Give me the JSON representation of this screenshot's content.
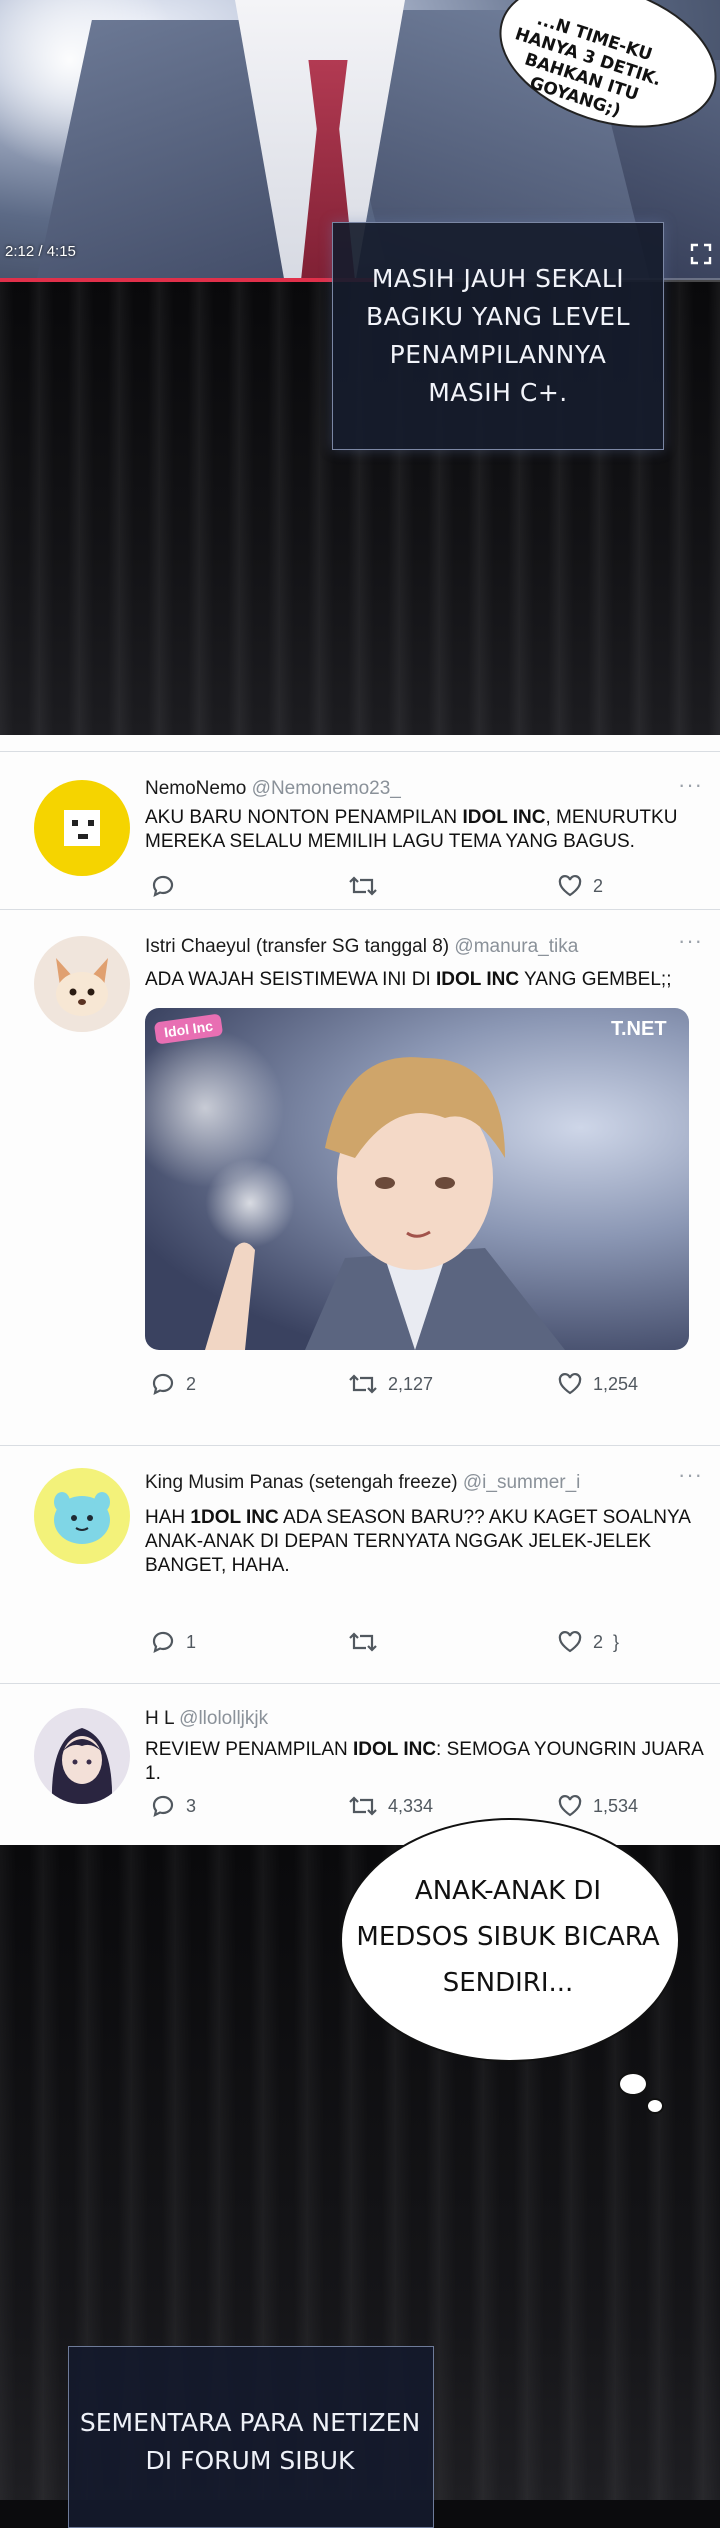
{
  "video": {
    "time": "2:12 / 4:15",
    "progress": 0.52,
    "speech_lines": [
      "...N TIME-KU",
      "HANYA 3 DETIK.",
      "BAHKAN ITU",
      "GOYANG;)"
    ],
    "caption": "MASIH JAUH SEKALI BAGIKU YANG LEVEL PENAMPILANNYA MASIH C+."
  },
  "tweets": [
    {
      "name": "NemoNemo",
      "handle": "@Nemonemo23_",
      "more": "···",
      "body_pre": "AKU BARU NONTON PENAMPILAN ",
      "body_bold": "IDOL INC",
      "body_post": ", MENURUTKU MEREKA SELALU MEMILIH LAGU TEMA YANG BAGUS.",
      "replies": "",
      "retweets": "",
      "likes": "2"
    },
    {
      "name": "Istri Chaeyul (transfer SG tanggal 8)",
      "handle": "@manura_tika",
      "more": "···",
      "body_pre": "ADA WAJAH SEISTIMEWA INI DI ",
      "body_bold": "IDOL INC",
      "body_post": " YANG GEMBEL;;",
      "image_badge": "Idol Inc",
      "image_watermark": "T.NET",
      "replies": "2",
      "retweets": "2,127",
      "likes": "1,254"
    },
    {
      "name": "King Musim Panas (setengah freeze)",
      "handle": "@i_summer_i",
      "more": "···",
      "body_pre": "HAH ",
      "body_bold": "1DOL INC",
      "body_post": " ADA SEASON BARU?? AKU KAGET SOALNYA ANAK-ANAK DI DEPAN TERNYATA NGGAK JELEK-JELEK BANGET, HAHA.",
      "replies": "1",
      "retweets": "",
      "likes": "2"
    },
    {
      "name": "H L",
      "handle": "@llololljkjk",
      "more": "",
      "body_pre": "REVIEW PENAMPILAN ",
      "body_bold": "IDOL INC",
      "body_post": ": SEMOGA YOUNGRIN JUARA 1.",
      "replies": "3",
      "retweets": "4,334",
      "likes": "1,534"
    }
  ],
  "bottom": {
    "bubble_text": "ANAK-ANAK DI MEDSOS SIBUK BICARA SENDIRI...",
    "caption": "SEMENTARA PARA NETIZEN DI FORUM SIBUK"
  },
  "colors": {
    "progress": "#e0304a",
    "caption_bg": "#161c2c",
    "feed_bg": "#fdfdfd",
    "handle": "#8a9199",
    "divider": "#d9dde2"
  },
  "icons": [
    "fullscreen-icon",
    "reply-icon",
    "retweet-icon",
    "like-icon",
    "more-icon"
  ]
}
